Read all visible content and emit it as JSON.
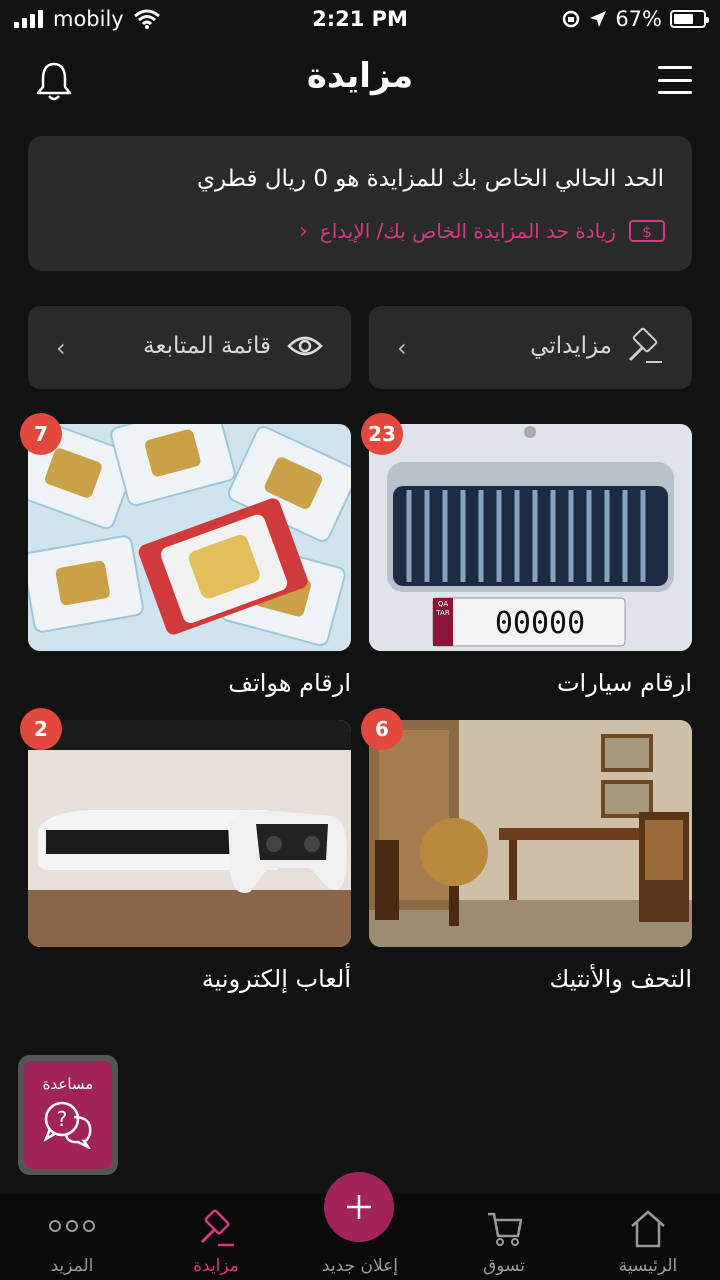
{
  "status_bar": {
    "carrier": "mobily",
    "time": "2:21 PM",
    "battery": "67%",
    "battery_level": 0.67
  },
  "header": {
    "title": "مزايدة"
  },
  "limit_card": {
    "text": "الحد الحالي الخاص بك للمزايدة هو 0 ريال قطري",
    "raise_link": "زيادة حد المزايدة الخاص بك/ الإيداع"
  },
  "quick_links": {
    "my_auctions": "مزايداتي",
    "watchlist": "قائمة المتابعة"
  },
  "categories": [
    {
      "name": "ارقام سيارات",
      "count": "23",
      "plate": "00000",
      "plate_country": "QATAR"
    },
    {
      "name": "ارقام هواتف",
      "count": "7"
    },
    {
      "name": "التحف والأنتيك",
      "count": "6"
    },
    {
      "name": "ألعاب إلكترونية",
      "count": "2"
    }
  ],
  "help": {
    "label": "مساعدة"
  },
  "bottom_nav": {
    "home": "الرئيسية",
    "shop": "تسوق",
    "new_ad": "إعلان جديد",
    "auction": "مزايدة",
    "more": "المزيد"
  },
  "colors": {
    "accent": "#a0235a",
    "accent_text": "#d5397f",
    "badge": "#e2483d",
    "card_bg": "#2a2a2a",
    "background": "#121212"
  }
}
